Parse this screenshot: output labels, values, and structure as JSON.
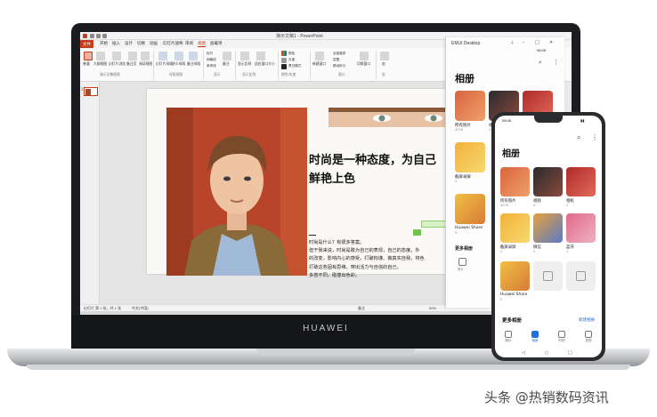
{
  "colors": {
    "ppt_accent": "#c43e1c",
    "emui_link": "#1f6fe0",
    "laptop_bezel": "#1b1c1f",
    "phone_body": "#2a2b2e"
  },
  "laptop": {
    "brand": "HUAWEI"
  },
  "powerpoint": {
    "window_title": "演示文稿1 - PowerPoint",
    "tabs": [
      "文件",
      "开始",
      "插入",
      "设计",
      "切换",
      "动画",
      "幻灯片放映",
      "审阅",
      "视图",
      "加载项"
    ],
    "active_tab": "视图",
    "ribbon_buttons": [
      "普通",
      "大纲视图",
      "幻灯片浏览",
      "备注页",
      "阅读视图",
      "幻灯片母版",
      "讲义母版",
      "备注母版",
      "标尺",
      "网格线",
      "参考线",
      "备注",
      "显示比例",
      "适应窗口大小",
      "颜色",
      "灰度",
      "黑白模式",
      "新建窗口",
      "全部重排",
      "层叠",
      "移动拆分",
      "切换窗口",
      "宏"
    ],
    "ribbon_groups": [
      "演示文稿视图",
      "母版视图",
      "显示",
      "显示比例",
      "颜色/灰度",
      "窗口",
      "宏"
    ],
    "thumbnail_number": "1",
    "slide": {
      "headline_line1": "时尚是一种态度，为自己",
      "headline_line2": "鲜艳上色",
      "body_lines": [
        "时尚是什么？有很多答案。",
        "但于我来说，时尚是敢为自己的表现，自己的态度。外",
        "的改变，影响内心的感受。打破拘谨、做真实自我，将色",
        "打破这些固有思维，穿出活力与自信的自己。",
        "多尝不同，碰撞出色彩。"
      ]
    },
    "status": {
      "slide_count": "幻灯片 第 1 张，共 1 张",
      "language": "中文(中国)",
      "notes": "备注",
      "zoom": "50%"
    }
  },
  "emui_desktop": {
    "window_title": "EMUI Desktop",
    "status_time": "08:08",
    "heading": "相册",
    "albums": [
      {
        "label": "所有照片",
        "count": "4278"
      },
      {
        "label": "视频",
        "count": "4"
      },
      {
        "label": "相机",
        "count": "2"
      },
      {
        "label": "截屏录屏",
        "count": "5"
      },
      {
        "label": "Huawei Share",
        "count": "5"
      }
    ],
    "more_albums": "更多相册",
    "bottom_item": "照片"
  },
  "phone": {
    "status_time": "08:08",
    "heading": "相册",
    "albums": [
      {
        "label": "所有照片",
        "count": "4278"
      },
      {
        "label": "视频",
        "count": "4"
      },
      {
        "label": "相机",
        "count": "2"
      },
      {
        "label": "截屏录屏",
        "count": "5"
      },
      {
        "label": "微信",
        "count": "5"
      },
      {
        "label": "蓝牙",
        "count": "1"
      },
      {
        "label": "Huawei Share",
        "count": "5"
      },
      {
        "label": "",
        "count": ""
      },
      {
        "label": "",
        "count": ""
      }
    ],
    "more_albums": "更多相册",
    "new_album": "新建相册",
    "nav": [
      "照片",
      "相册",
      "时刻",
      "发现"
    ],
    "nav_active_index": 1
  },
  "watermark": "头条 @热销数码资讯"
}
